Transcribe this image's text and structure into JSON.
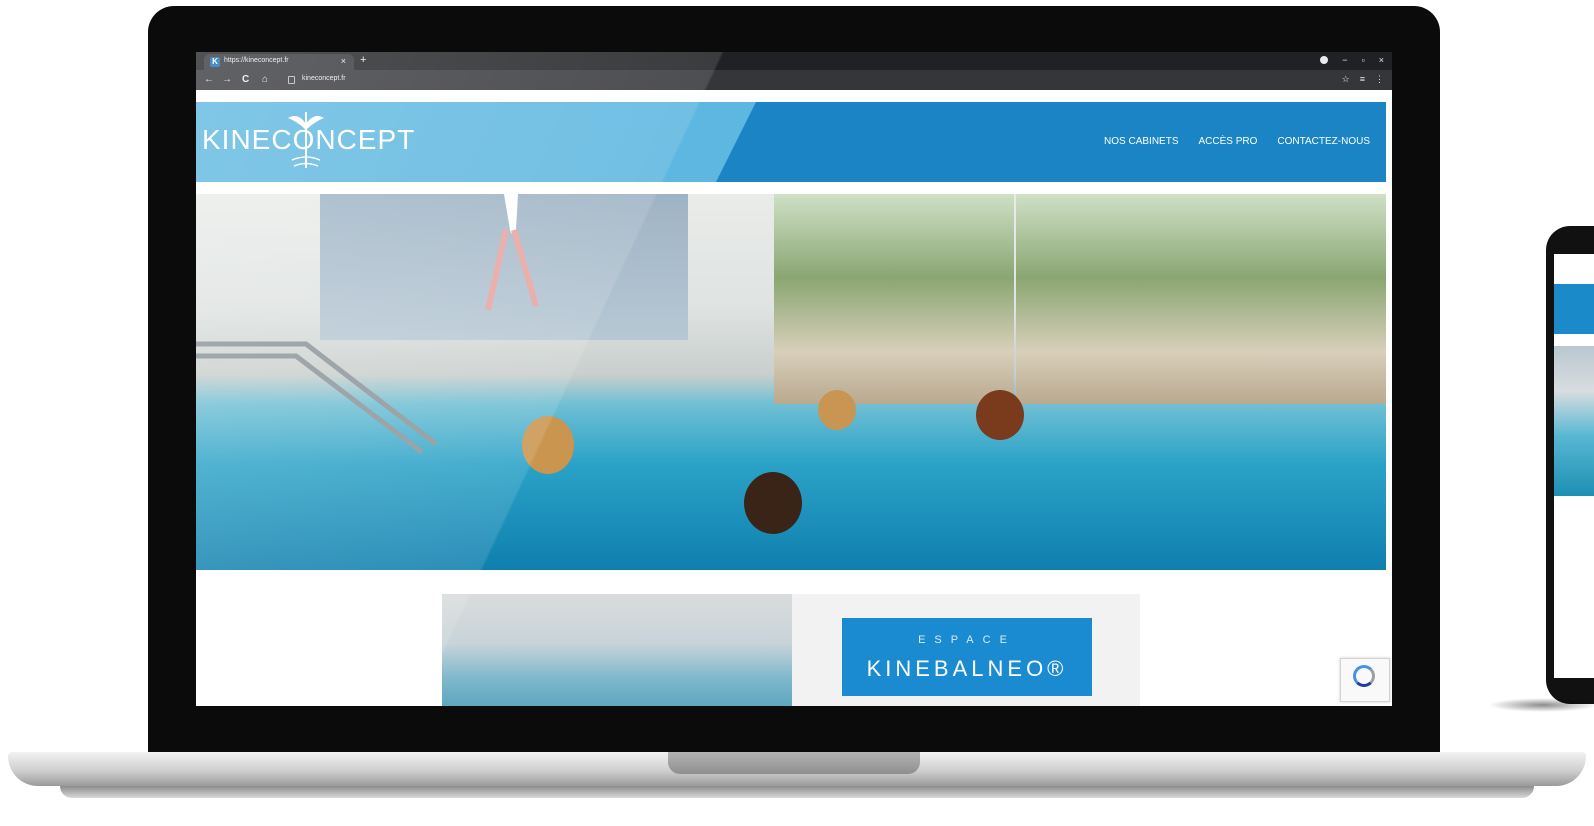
{
  "browser": {
    "tab_title": "https://kineconcept.fr",
    "tab_favicon": "K",
    "tab_close": "×",
    "new_tab": "+",
    "url": "kineconcept.fr",
    "window_controls": {
      "minimize": "−",
      "maximize": "▫",
      "close": "×"
    },
    "nav": {
      "back": "←",
      "forward": "→",
      "reload": "C",
      "home": "⌂"
    },
    "toolbar_right": {
      "star": "☆",
      "playlist": "≡",
      "menu": "⋮"
    }
  },
  "site": {
    "logo": "KINECONCEPT",
    "nav_items": [
      "NOS CABINETS",
      "ACCÈS PRO",
      "CONTACTEZ-NOUS"
    ],
    "promo": {
      "small": "ESPACE",
      "big": "KINEBALNEO®"
    }
  },
  "colors": {
    "header_blue": "#1a84c4",
    "header_light": "#5db7e0",
    "badge_blue": "#1a8bd0",
    "chrome_dark": "#202124"
  },
  "icons": {
    "favicon": "kineconcept-k-icon",
    "lock": "lock-icon",
    "captcha": "recaptcha-icon"
  }
}
